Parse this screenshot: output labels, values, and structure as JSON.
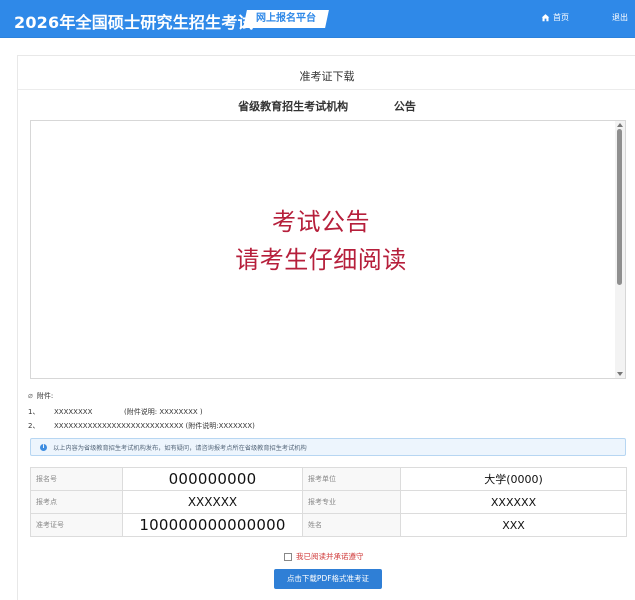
{
  "header": {
    "title": "2026年全国硕士研究生招生考试",
    "portal_badge": "网上报名平台",
    "home_label": "首页",
    "logout_label": "退出",
    "home_icon": "home-icon",
    "background_color": "#2f89e8"
  },
  "page": {
    "title": "准考证下载",
    "announcement_heading_left": "省级教育招生考试机构",
    "announcement_heading_right": "公告"
  },
  "notice": {
    "line_1": "考试公告",
    "line_2": "请考生仔细阅读",
    "text_color": "#b61f3b"
  },
  "attachments": {
    "label": "附件:",
    "items": [
      {
        "index": "1、",
        "name": "XXXXXXXX",
        "note": "(附件说明: XXXXXXXX )"
      },
      {
        "index": "2、",
        "name": "XXXXXXXXXXXXXXXXXXXXXXXXXXX",
        "note": "(附件说明:XXXXXXX)"
      }
    ]
  },
  "alert": {
    "text": "以上内容为省级教育招生考试机构发布，如有疑问，请咨询报考点所在省级教育招生考试机构",
    "icon": "info-icon"
  },
  "candidate_info": {
    "registration_number_label": "报名号",
    "registration_number": "000000000",
    "applied_unit_label": "报考单位",
    "applied_unit": "大学(0000)",
    "exam_site_label": "报考点",
    "exam_site": "XXXXXX",
    "major_label": "报考专业",
    "major": "XXXXXX",
    "admission_ticket_label": "准考证号",
    "admission_ticket_number": "100000000000000",
    "name_label": "姓名",
    "name": "XXX"
  },
  "actions": {
    "agreement_label": "我已阅读并承诺遵守",
    "download_button": "点击下载PDF格式准考证"
  }
}
